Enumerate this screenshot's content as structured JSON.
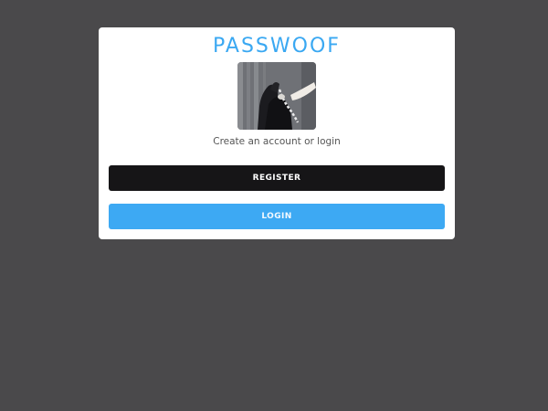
{
  "card": {
    "title": "PASSWOOF",
    "photo_icon": "photo-dog-on-phone",
    "subtitle": "Create an account or login",
    "register_label": "REGISTER",
    "login_label": "LOGIN"
  },
  "colors": {
    "background": "#4a494b",
    "title": "#3aa8f2",
    "register_bg": "#161517",
    "login_bg": "#3da9f3"
  }
}
